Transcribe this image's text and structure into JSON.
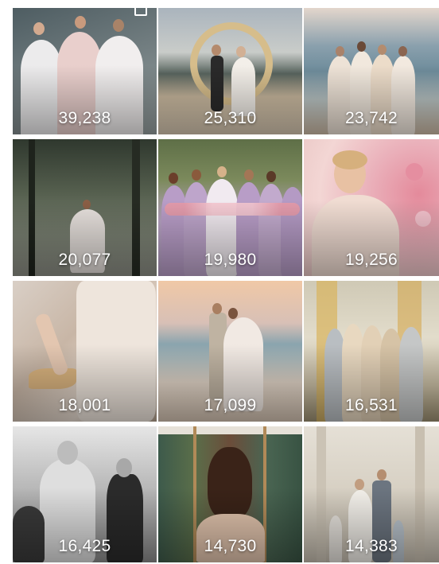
{
  "gallery": {
    "tiles": [
      {
        "count": "39,238",
        "subject": "three bridesmaids in white and blush tulle gowns",
        "colors": [
          "#5d6a6f",
          "#e9e2de",
          "#e8c9c6"
        ]
      },
      {
        "count": "25,310",
        "subject": "couple under dried grass arch by lake and mountains",
        "colors": [
          "#9fa9b2",
          "#d9c39a",
          "#2b2b2b"
        ]
      },
      {
        "count": "23,742",
        "subject": "bridal party in pale dresses by lake",
        "colors": [
          "#7f9aab",
          "#e9dccb",
          "#c9b09a"
        ]
      },
      {
        "count": "20,077",
        "subject": "bride in foggy forest",
        "colors": [
          "#3b4236",
          "#6d7466",
          "#d9d3cf"
        ]
      },
      {
        "count": "19,980",
        "subject": "bridesmaids in lilac dresses with bouquets",
        "colors": [
          "#6b7b53",
          "#b8a3c6",
          "#efc9cf"
        ]
      },
      {
        "count": "19,256",
        "subject": "bride among pink peony flowers",
        "colors": [
          "#e7b7bd",
          "#f3dfd5",
          "#c98590"
        ]
      },
      {
        "count": "18,001",
        "subject": "close-up of lace gown and gold heels",
        "colors": [
          "#c9b9ad",
          "#e8dcd2",
          "#a38b78"
        ]
      },
      {
        "count": "17,099",
        "subject": "couple embracing on beach at sunset",
        "colors": [
          "#e0c7b4",
          "#8da3ad",
          "#d7c8ba"
        ]
      },
      {
        "count": "16,531",
        "subject": "bridesmaids in champagne dresses in ornate hall",
        "colors": [
          "#c8c0a8",
          "#e4d7bf",
          "#9a8e6f"
        ]
      },
      {
        "count": "16,425",
        "subject": "black and white emotional bride and father",
        "colors": [
          "#6b6b6b",
          "#d8d8d8",
          "#2a2a2a"
        ]
      },
      {
        "count": "14,730",
        "subject": "bride with dark hair in front of floral screens",
        "colors": [
          "#3d5b4e",
          "#6b4d3a",
          "#d6b9a3"
        ]
      },
      {
        "count": "14,383",
        "subject": "family with kids at white stone chapel",
        "colors": [
          "#d8d2c6",
          "#eae6de",
          "#8a8f95"
        ]
      }
    ]
  }
}
